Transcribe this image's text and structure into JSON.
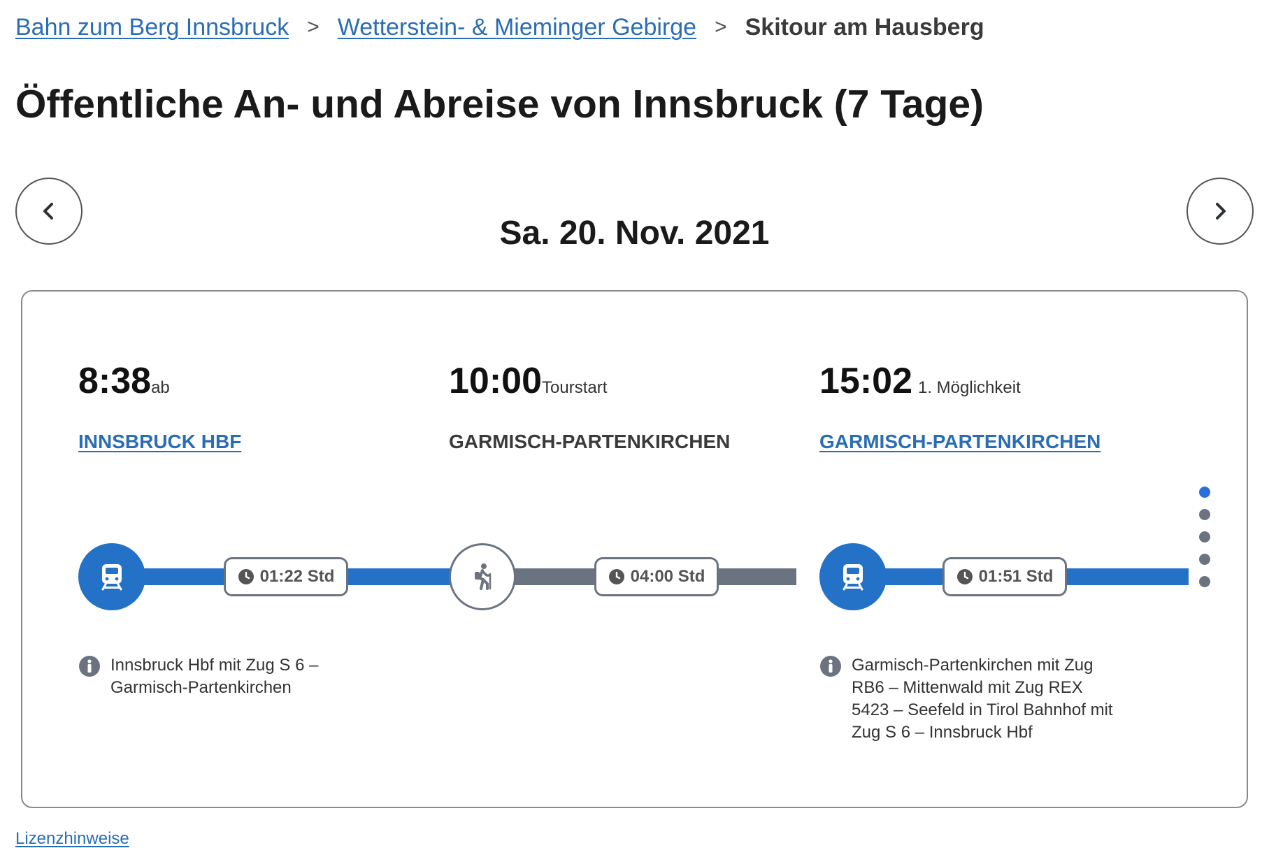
{
  "breadcrumb": {
    "items": [
      {
        "label": "Bahn zum Berg Innsbruck"
      },
      {
        "label": "Wetterstein- & Mieminger Gebirge"
      },
      {
        "label": "Skitour am Hausberg"
      }
    ],
    "separator": ">"
  },
  "page_title": "Öffentliche An- und Abreise von Innsbruck (7 Tage)",
  "date_label": "Sa. 20. Nov. 2021",
  "nav": {
    "prev_icon": "chevron-left-icon",
    "next_icon": "chevron-right-icon"
  },
  "timeline": {
    "departure": {
      "time": "8:38",
      "suffix": "ab",
      "station": "INNSBRUCK HBF",
      "mode": "train-icon",
      "duration": "01:22 Std",
      "info": "Innsbruck Hbf mit Zug S 6 – Garmisch-Partenkirchen"
    },
    "tour": {
      "time": "10:00",
      "suffix": "Tourstart",
      "station": "GARMISCH-PARTENKIRCHEN",
      "mode": "hiker-icon",
      "duration": "04:00 Std"
    },
    "return": {
      "time": "15:02",
      "suffix": "1. Möglichkeit",
      "station": "GARMISCH-PARTENKIRCHEN",
      "mode": "train-icon",
      "duration": "01:51 Std",
      "info": "Garmisch-Partenkirchen mit Zug RB6 – Mittenwald mit Zug REX 5423 – Seefeld in Tirol Bahnhof mit Zug S 6 – Innsbruck Hbf"
    }
  },
  "pagination": {
    "total": 5,
    "active": 1
  },
  "footer": {
    "license_link": "Lizenzhinweise"
  },
  "colors": {
    "accent": "#2471c8",
    "link": "#2a6db5",
    "gray_track": "#6c7380",
    "active_dot": "#2a6de0"
  }
}
